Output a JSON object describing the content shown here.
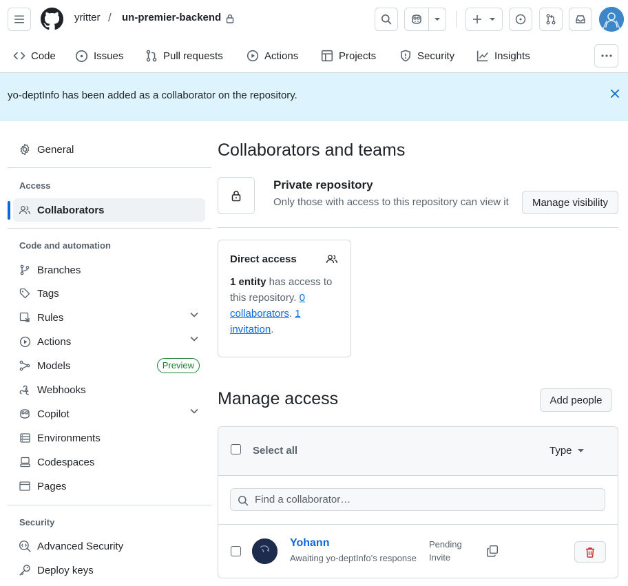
{
  "header": {
    "owner": "yritter",
    "separator": "/",
    "repo": "un-premier-backend"
  },
  "tabs": [
    {
      "label": "Code",
      "icon": "code-icon"
    },
    {
      "label": "Issues",
      "icon": "issue-icon"
    },
    {
      "label": "Pull requests",
      "icon": "pull-request-icon"
    },
    {
      "label": "Actions",
      "icon": "play-icon"
    },
    {
      "label": "Projects",
      "icon": "table-icon"
    },
    {
      "label": "Security",
      "icon": "shield-icon"
    },
    {
      "label": "Insights",
      "icon": "graph-icon"
    }
  ],
  "flash": {
    "message": "yo-deptInfo has been added as a collaborator on the repository."
  },
  "sidebar": {
    "general": "General",
    "access_heading": "Access",
    "collaborators": "Collaborators",
    "code_heading": "Code and automation",
    "items": [
      {
        "label": "Branches",
        "icon": "branch-icon"
      },
      {
        "label": "Tags",
        "icon": "tag-icon"
      },
      {
        "label": "Rules",
        "icon": "rules-icon"
      },
      {
        "label": "Actions",
        "icon": "play-icon"
      },
      {
        "label": "Models",
        "icon": "models-icon",
        "badge": "Preview"
      },
      {
        "label": "Webhooks",
        "icon": "webhook-icon"
      },
      {
        "label": "Copilot",
        "icon": "copilot-icon"
      },
      {
        "label": "Environments",
        "icon": "server-icon"
      },
      {
        "label": "Codespaces",
        "icon": "codespaces-icon"
      },
      {
        "label": "Pages",
        "icon": "browser-icon"
      }
    ],
    "security_heading": "Security",
    "security_items": [
      {
        "label": "Advanced Security",
        "icon": "codescan-icon"
      },
      {
        "label": "Deploy keys",
        "icon": "key-icon"
      }
    ]
  },
  "main": {
    "title": "Collaborators and teams",
    "private_title": "Private repository",
    "private_desc": "Only those with access to this repository can view it",
    "manage_visibility": "Manage visibility",
    "direct_access": {
      "title": "Direct access",
      "count": "1 entity",
      "text_after_count": " has access to this repository. ",
      "collaborators_link": "0 collaborators",
      "sep": ". ",
      "invitations_link": "1 invitation",
      "end": "."
    },
    "manage_title": "Manage access",
    "add_people": "Add people",
    "select_all": "Select all",
    "type_label": "Type",
    "search_placeholder": "Find a collaborator…",
    "member": {
      "name": "Yohann",
      "sub": "Awaiting yo-deptInfo’s response",
      "status": "Pending Invite"
    }
  },
  "colors": {
    "accent": "#0969da",
    "flash_bg": "#ddf4ff",
    "danger": "#d1242f",
    "success": "#1a7f37"
  }
}
